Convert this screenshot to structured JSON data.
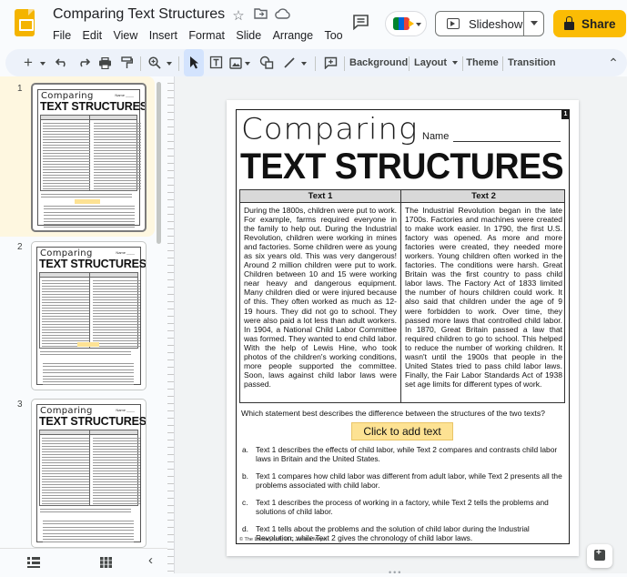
{
  "app": {
    "document_title": "Comparing Text Structures",
    "menus": [
      "File",
      "Edit",
      "View",
      "Insert",
      "Format",
      "Slide",
      "Arrange",
      "Too"
    ],
    "slideshow_label": "Slideshow",
    "share_label": "Share"
  },
  "toolbar": {
    "background_label": "Background",
    "layout_label": "Layout",
    "theme_label": "Theme",
    "transition_label": "Transition"
  },
  "filmstrip": {
    "slide_numbers": [
      "1",
      "2",
      "3"
    ],
    "thumb_comparing": "Comparing",
    "thumb_title": "TEXT STRUCTURES"
  },
  "slide": {
    "page_number": "1",
    "heading_script": "Comparing",
    "name_label": "Name",
    "heading_bold": "TEXT STRUCTURES",
    "text1_header": "Text 1",
    "text2_header": "Text 2",
    "text1": "During the 1800s, children were put to work. For example, farms required everyone in the family to help out. During the Industrial Revolution, children were working in mines and factories. Some children were as young as six years old. This was very dangerous! Around 2 million children were put to work. Children between 10 and 15 were working near heavy and dangerous equipment. Many children died or were injured because of this. They often worked as much as 12-19 hours. They did not go to school. They were also paid a lot less than adult workers. In 1904, a National Child Labor Committee was formed. They wanted to end child labor. With the help of Lewis Hine, who took photos of the children's working conditions, more people supported the committee. Soon, laws against child labor laws were passed.",
    "text2": "The Industrial Revolution began in the late 1700s. Factories and machines were created to make work easier. In 1790, the first U.S. factory was opened. As more and more factories were created, they needed more workers. Young children often worked in the factories. The conditions were harsh. Great Britain was the first country to pass child labor laws. The Factory Act of 1833 limited the number of hours children could work. It also said that children under the age of 9 were forbidden to work. Over time, they passed more laws that controlled child labor. In 1870, Great Britain passed a law that required children to go to school. This helped to reduce the number of working children. It wasn't until the 1900s that people in the United States tried to pass child labor laws. Finally, the Fair Labor Standards Act of 1938 set age limits for different types of work.",
    "question": "Which statement best describes the difference between the structures of the two texts?",
    "placeholder": "Click to add text",
    "options": [
      {
        "letter": "a.",
        "text": "Text 1 describes the effects of child labor, while Text 2 compares and contrasts child labor laws in Britain and the United States."
      },
      {
        "letter": "b.",
        "text": "Text 1 compares how child labor was different from adult labor, while Text 2 presents all the problems associated with child labor."
      },
      {
        "letter": "c.",
        "text": "Text 1 describes the process of working in a factory, while Text 2 tells the problems and solutions of child labor."
      },
      {
        "letter": "d.",
        "text": "Text 1 tells about the problems and the solution of child labor during the Industrial Revolution, while Text 2 gives the chronology of child labor laws."
      }
    ],
    "copyright": "© The Literacy Loft, LLC Jessica Meyer"
  }
}
